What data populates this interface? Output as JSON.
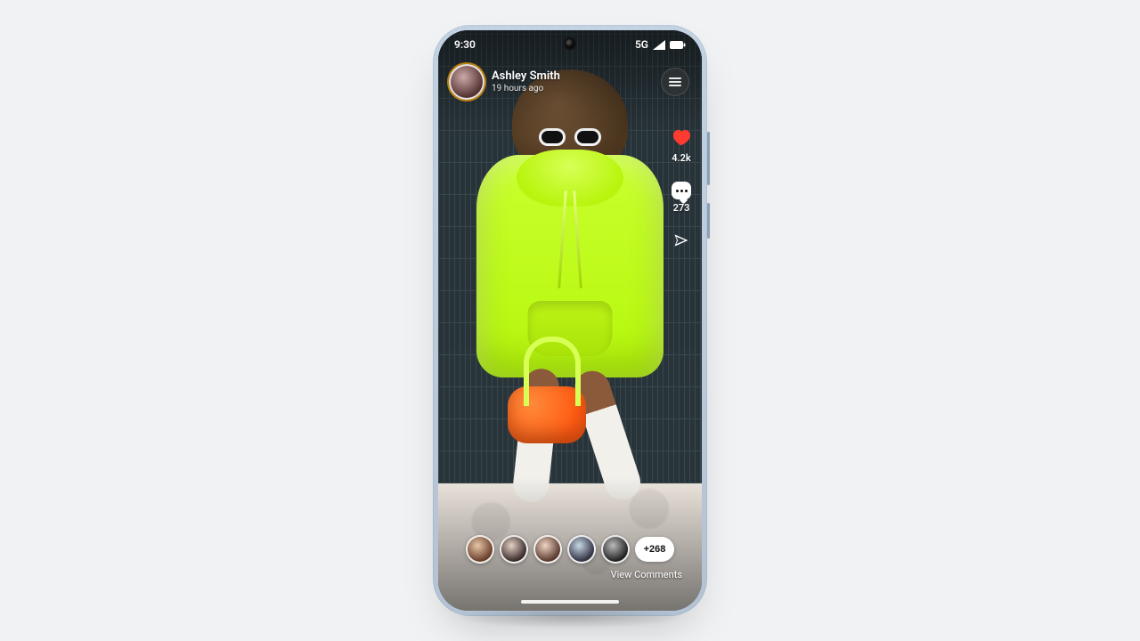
{
  "statusbar": {
    "time": "9:30",
    "network_label": "5G"
  },
  "post": {
    "author_name": "Ashley Smith",
    "timestamp_label": "19 hours ago"
  },
  "rail": {
    "likes_count": "4.2k",
    "comments_count": "273"
  },
  "viewers": {
    "more_label": "+268",
    "view_comments_label": "View Comments"
  },
  "colors": {
    "heart": "#ff3b30",
    "hoodie": "#b5f70b",
    "bag": "#ff5a12"
  }
}
